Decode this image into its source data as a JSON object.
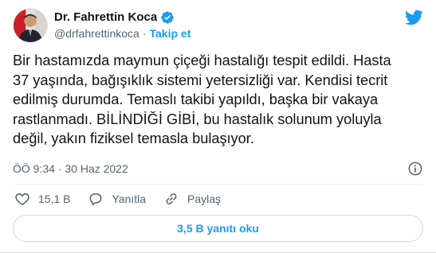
{
  "author": {
    "name": "Dr. Fahrettin Koca",
    "handle": "@drfahrettinkoca",
    "separator": "·",
    "follow_label": "Takip et"
  },
  "tweet": {
    "text": "Bir hastamızda maymun çiçeği hastalığı tespit edildi. Hasta\n37 yaşında, bağışıklık sistemi yetersizliği var. Kendisi tecrit\nedilmiş durumda. Temaslı takibi yapıldı, başka bir vakaya\nrastlanmadı. BİLİNDİĞİ GİBİ, bu hastalık solunum yoluyla\ndeğil, yakın fiziksel temasla bulaşıyor.",
    "timestamp": "ÖÖ 9:34 · 30 Haz 2022"
  },
  "actions": {
    "likes": "15,1 B",
    "reply_label": "Yanıtla",
    "share_label": "Paylaş"
  },
  "read_replies_label": "3,5 B yanıtı oku",
  "colors": {
    "accent": "#1d9bf0",
    "text": "#0f1419",
    "muted": "#536471"
  },
  "icons": {
    "brand": "twitter-bird-icon",
    "verified": "verified-badge-icon",
    "info": "info-icon",
    "like": "heart-icon",
    "reply": "reply-bubble-icon",
    "share": "share-icon"
  }
}
